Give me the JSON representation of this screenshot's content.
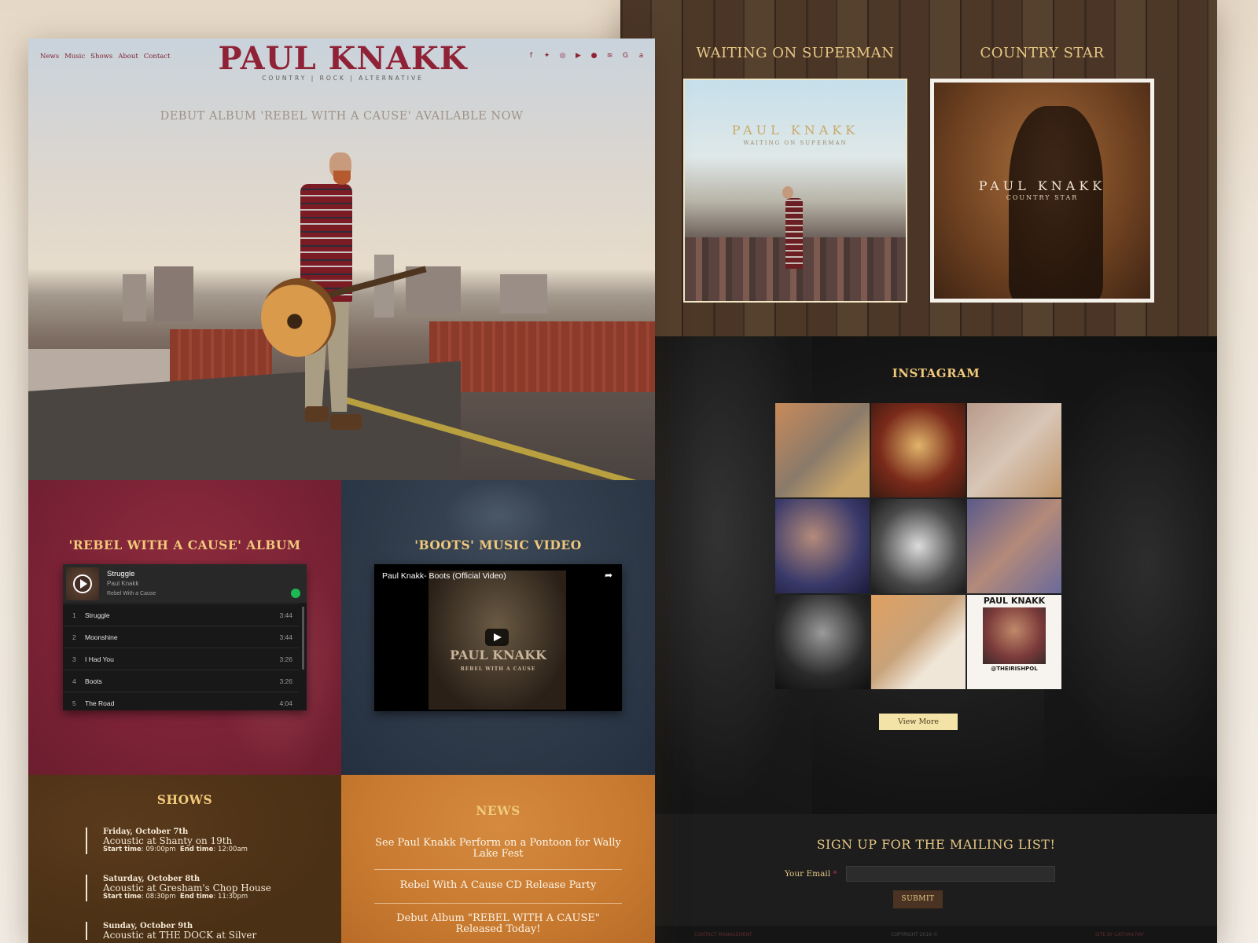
{
  "nav": {
    "items": [
      "News",
      "Music",
      "Shows",
      "About",
      "Contact"
    ]
  },
  "brand": {
    "name": "PAUL KNAKK",
    "genres": "COUNTRY | ROCK | ALTERNATIVE"
  },
  "social_icons": [
    "facebook-icon",
    "twitter-icon",
    "instagram-icon",
    "youtube-icon",
    "apple-icon",
    "spotify-icon",
    "google-play-icon",
    "amazon-icon"
  ],
  "hero": {
    "tagline": "DEBUT ALBUM 'REBEL WITH A CAUSE' AVAILABLE NOW"
  },
  "album_section": {
    "title": "'REBEL WITH A CAUSE' ALBUM",
    "player": {
      "track": "Struggle",
      "artist": "Paul Knakk",
      "album": "Rebel With a Cause",
      "tracks": [
        {
          "num": "1",
          "name": "Struggle",
          "duration": "3:44"
        },
        {
          "num": "2",
          "name": "Moonshine",
          "duration": "3:44"
        },
        {
          "num": "3",
          "name": "I Had You",
          "duration": "3:26"
        },
        {
          "num": "4",
          "name": "Boots",
          "duration": "3:26"
        },
        {
          "num": "5",
          "name": "The Road",
          "duration": "4:04"
        }
      ]
    }
  },
  "video_section": {
    "title": "'BOOTS' MUSIC VIDEO",
    "video_title": "Paul Knakk- Boots (Official Video)",
    "cover_name": "PAUL KNAKK",
    "cover_sub": "REBEL WITH A CAUSE"
  },
  "shows_section": {
    "title": "SHOWS",
    "start_label": "Start time",
    "end_label": "End time",
    "shows": [
      {
        "date": "Friday, October 7th",
        "venue": "Acoustic at Shanty on 19th",
        "start": "09:00pm",
        "end": "12:00am"
      },
      {
        "date": "Saturday, October 8th",
        "venue": "Acoustic at Gresham's Chop House",
        "start": "08:30pm",
        "end": "11:30pm"
      },
      {
        "date": "Sunday, October 9th",
        "venue": "Acoustic at THE DOCK at Silver"
      }
    ]
  },
  "news_section": {
    "title": "NEWS",
    "items": [
      "See Paul Knakk Perform on a Pontoon for Wally Lake Fest",
      "Rebel With A Cause CD Release Party",
      "Debut Album \"REBEL WITH A CAUSE\" Released Today!"
    ]
  },
  "singles": [
    {
      "title": "WAITING ON SUPERMAN",
      "cover_name": "PAUL KNAKK",
      "cover_sub": "WAITING ON SUPERMAN"
    },
    {
      "title": "COUNTRY STAR",
      "cover_name": "PAUL KNAKK",
      "cover_sub": "COUNTRY STAR"
    }
  ],
  "instagram": {
    "title": "INSTAGRAM",
    "button": "View More",
    "poster_title": "PAUL KNAKK",
    "poster_handle": "@THEIRISHPOL"
  },
  "mailing": {
    "title": "SIGN UP FOR THE MAILING LIST!",
    "label": "Your Email",
    "required_mark": "*",
    "email_value": "",
    "submit": "SUBMIT"
  },
  "footer": {
    "left": "CONTACT MANAGEMENT",
    "center": "COPYRIGHT 2016 ©",
    "right": "SITE BY CATHAN RAY"
  },
  "colors": {
    "brand_red": "#8f2236",
    "gold": "#f0c97a",
    "album_panel": "#7b2236",
    "video_panel": "#2e3948",
    "shows_panel": "#4a3015",
    "news_panel": "#c87a30"
  }
}
